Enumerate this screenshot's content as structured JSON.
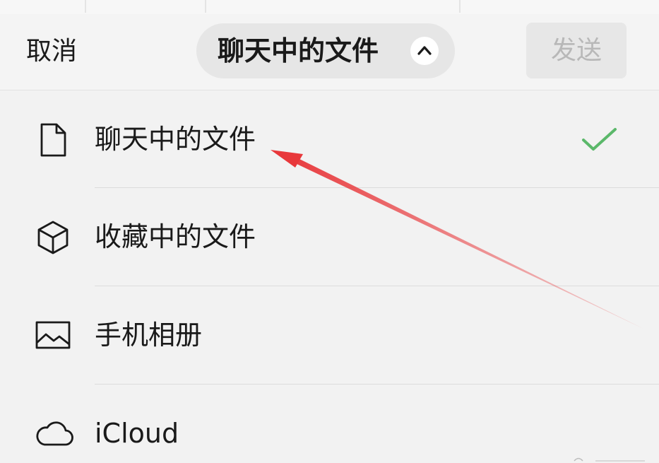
{
  "header": {
    "cancel_label": "取消",
    "title": "聊天中的文件",
    "send_label": "发送"
  },
  "menu": {
    "items": [
      {
        "label": "聊天中的文件",
        "icon": "document-icon",
        "selected": true
      },
      {
        "label": "收藏中的文件",
        "icon": "cube-icon",
        "selected": false
      },
      {
        "label": "手机相册",
        "icon": "photo-album-icon",
        "selected": false
      },
      {
        "label": "iCloud",
        "icon": "cloud-icon",
        "selected": false
      }
    ]
  },
  "colors": {
    "accent_green": "#5bb86a",
    "annotation_red": "#e8383b",
    "disabled_text": "#b8b8b8"
  }
}
